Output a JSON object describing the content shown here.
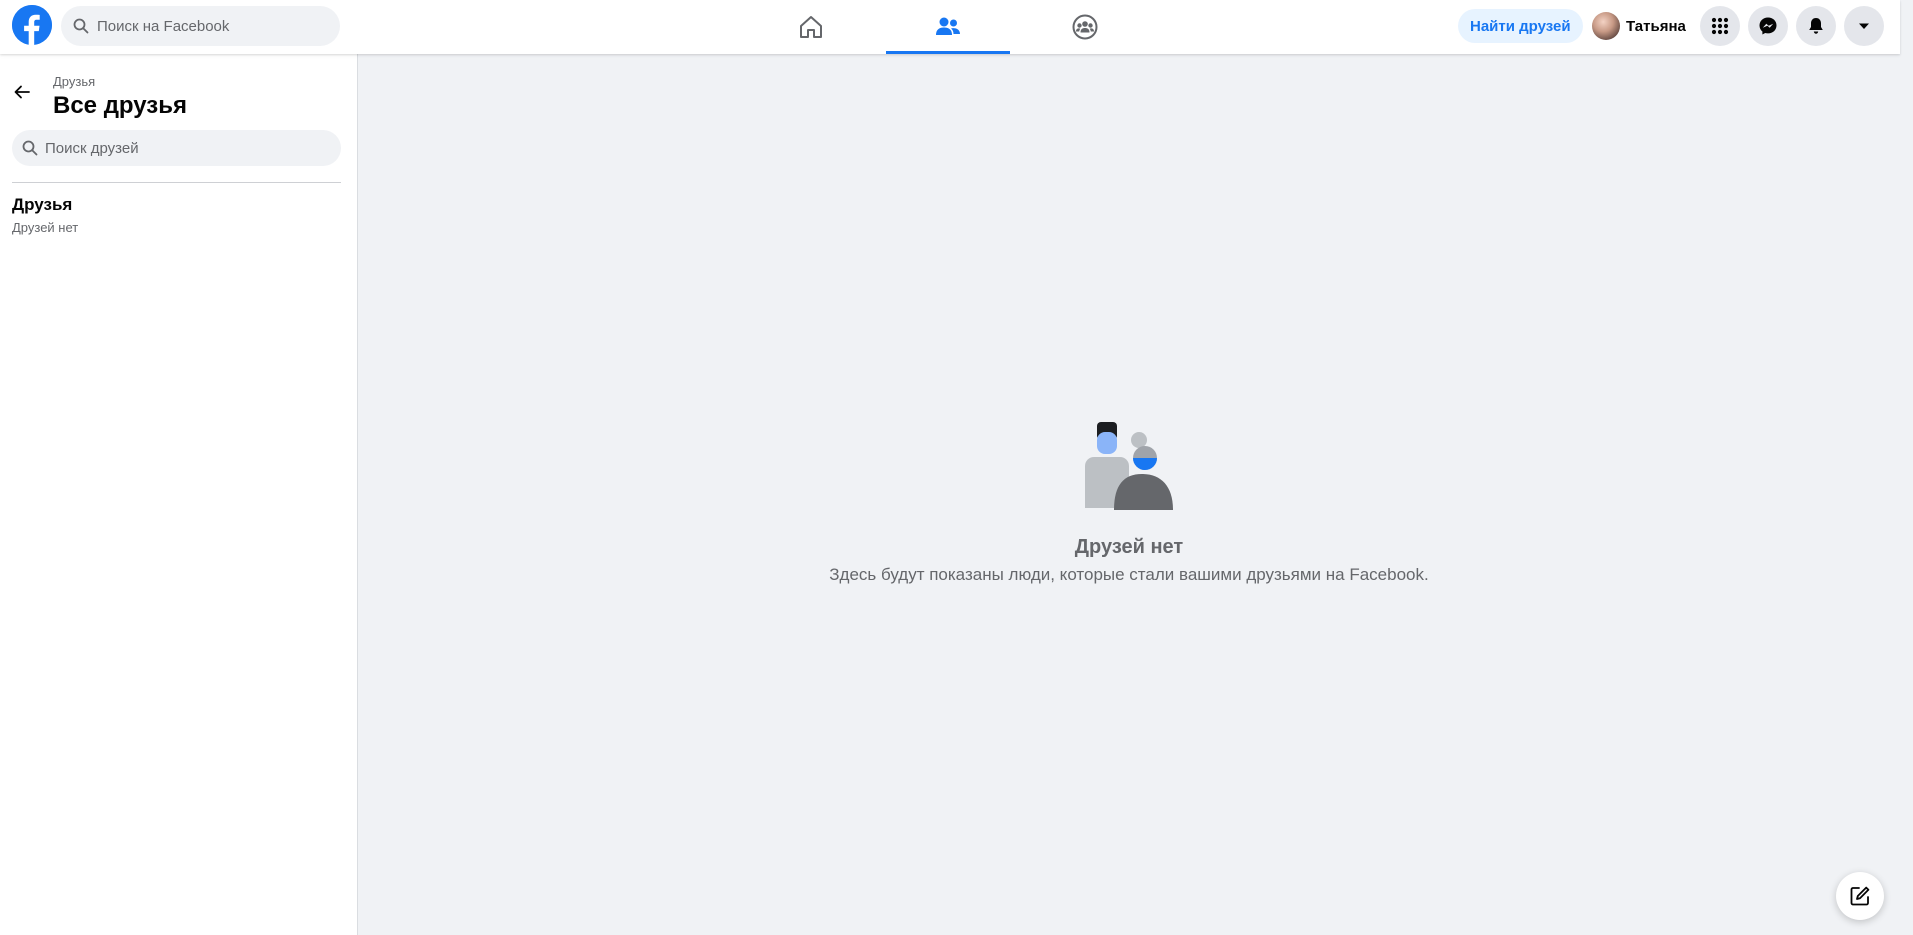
{
  "header": {
    "search_placeholder": "Поиск на Facebook",
    "find_friends_label": "Найти друзей",
    "profile_name": "Татьяна",
    "nav_tabs": [
      {
        "name": "home",
        "icon": "home-icon",
        "active": false
      },
      {
        "name": "friends",
        "icon": "friends-icon",
        "active": true
      },
      {
        "name": "groups",
        "icon": "groups-icon",
        "active": false
      }
    ],
    "right_buttons": [
      "menu-grid-icon",
      "messenger-icon",
      "bell-icon",
      "chevron-down-icon"
    ]
  },
  "sidebar": {
    "breadcrumb": "Друзья",
    "title": "Все друзья",
    "search_placeholder": "Поиск друзей",
    "section_title": "Друзья",
    "section_subtitle": "Друзей нет"
  },
  "main": {
    "empty_title": "Друзей нет",
    "empty_description": "Здесь будут показаны люди, которые стали вашими друзьями на Facebook."
  },
  "colors": {
    "brand": "#1877f2",
    "page_bg": "#f0f2f5",
    "secondary_text": "#65676b",
    "find_friends_bg": "#e7f3ff"
  }
}
